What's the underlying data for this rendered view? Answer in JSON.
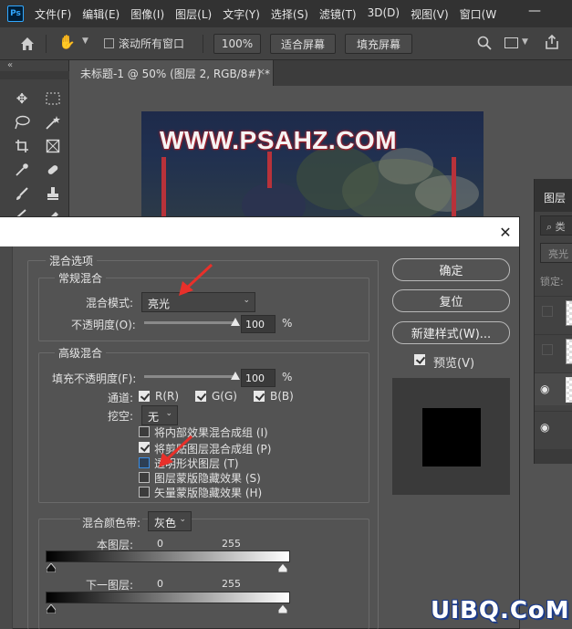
{
  "app": {
    "logo": "Ps"
  },
  "menubar": {
    "items": [
      "文件(F)",
      "编辑(E)",
      "图像(I)",
      "图层(L)",
      "文字(Y)",
      "选择(S)",
      "滤镜(T)",
      "3D(D)",
      "视图(V)",
      "窗口(W"
    ],
    "minimize": "—"
  },
  "options_bar": {
    "scroll_all_label": "滚动所有窗口",
    "zoom_button": "100%",
    "fit_screen_button": "适合屏幕",
    "fill_screen_button": "填充屏幕"
  },
  "toolbar": {
    "collapse": "«"
  },
  "document": {
    "tab_title": "未标题-1 @ 50% (图层 2, RGB/8#) *",
    "tab_close": "×",
    "canvas_text": "WWW.PSAHZ.COM"
  },
  "layers_panel": {
    "tab": "图层",
    "search_placeholder": "类",
    "blend_mode": "亮光",
    "lock_label": "锁定:"
  },
  "dialog": {
    "close": "✕",
    "section_blend_options": "混合选项",
    "general": {
      "legend": "常规混合",
      "mode_label": "混合模式:",
      "mode_value": "亮光",
      "opacity_label": "不透明度(O):",
      "opacity_value": "100",
      "opacity_unit": "%",
      "opacity_level": 1.0
    },
    "advanced": {
      "legend": "高级混合",
      "fill_opacity_label": "填充不透明度(F):",
      "fill_opacity_value": "100",
      "fill_opacity_unit": "%",
      "fill_opacity_level": 1.0,
      "channels_label": "通道:",
      "channel_r": "R(R)",
      "channel_g": "G(G)",
      "channel_b": "B(B)",
      "knockout_label": "挖空:",
      "knockout_value": "无",
      "options": [
        {
          "label": "将内部效果混合成组 (I)",
          "checked": false
        },
        {
          "label": "将剪贴图层混合成组 (P)",
          "checked": true
        },
        {
          "label": "透明形状图层 (T)",
          "checked": false
        },
        {
          "label": "图层蒙版隐藏效果 (S)",
          "checked": false
        },
        {
          "label": "矢量蒙版隐藏效果 (H)",
          "checked": false
        }
      ]
    },
    "blend_if": {
      "label": "混合颜色带:",
      "value": "灰色",
      "this_layer_label": "本图层:",
      "this_layer_min": "0",
      "this_layer_max": "255",
      "under_layer_label": "下一图层:",
      "under_layer_min": "0",
      "under_layer_max": "255"
    },
    "buttons": {
      "ok": "确定",
      "reset": "复位",
      "new_style": "新建样式(W)...",
      "preview": "预览(V)"
    },
    "accent_arrow_color": "#e8302a"
  },
  "watermark": "UiBQ.CoM"
}
